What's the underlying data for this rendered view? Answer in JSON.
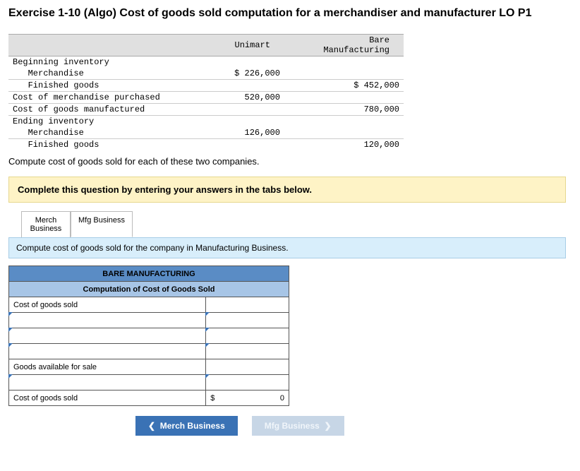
{
  "title": "Exercise 1-10 (Algo) Cost of goods sold computation for a merchandiser and manufacturer LO P1",
  "cols": {
    "c1": "Unimart",
    "c2": "Bare",
    "c2b": "Manufacturing"
  },
  "rows": {
    "r1": "Beginning inventory",
    "r2": "   Merchandise",
    "r3": "   Finished goods",
    "r4": "Cost of merchandise purchased",
    "r5": "Cost of goods manufactured",
    "r6": "Ending inventory",
    "r7": "   Merchandise",
    "r8": "   Finished goods"
  },
  "vals": {
    "v2a": "$ 226,000",
    "v3b": "$ 452,000",
    "v4a": "520,000",
    "v5b": "780,000",
    "v7a": "126,000",
    "v8b": "120,000"
  },
  "instruction": "Compute cost of goods sold for each of these two companies.",
  "banner": "Complete this question by entering your answers in the tabs below.",
  "tabs": {
    "t1a": "Merch",
    "t1b": "Business",
    "t2": "Mfg Business"
  },
  "subinstr": "Compute cost of goods sold for the company in Manufacturing Business.",
  "ws": {
    "title": "BARE MANUFACTURING",
    "sub": "Computation of Cost of Goods Sold",
    "r1": "Cost of goods sold",
    "r5": "Goods available for sale",
    "r7": "Cost of goods sold",
    "total_sym": "$",
    "total_val": "0"
  },
  "nav": {
    "prev": "Merch Business",
    "next": "Mfg Business"
  }
}
